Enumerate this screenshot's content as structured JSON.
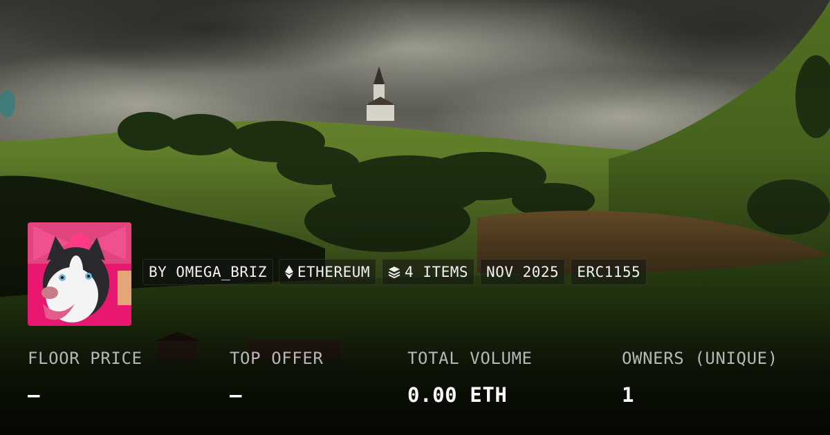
{
  "collection": {
    "creator_chip": "BY OMEGA_BRIZ",
    "chain_chip": "ETHEREUM",
    "chain_icon": "ethereum-icon",
    "items_chip": "4 ITEMS",
    "items_icon": "layers-icon",
    "date_chip": "NOV 2025",
    "standard_chip": "ERC1155"
  },
  "stats": [
    {
      "label": "FLOOR PRICE",
      "value": "–"
    },
    {
      "label": "TOP OFFER",
      "value": "–"
    },
    {
      "label": "TOTAL VOLUME",
      "value": "0.00 ETH"
    },
    {
      "label": "OWNERS (UNIQUE)",
      "value": "1"
    }
  ],
  "colors": {
    "stat_label": "#b5b7b9",
    "stat_value": "#ffffff",
    "avatar_background": "#e8176f"
  }
}
